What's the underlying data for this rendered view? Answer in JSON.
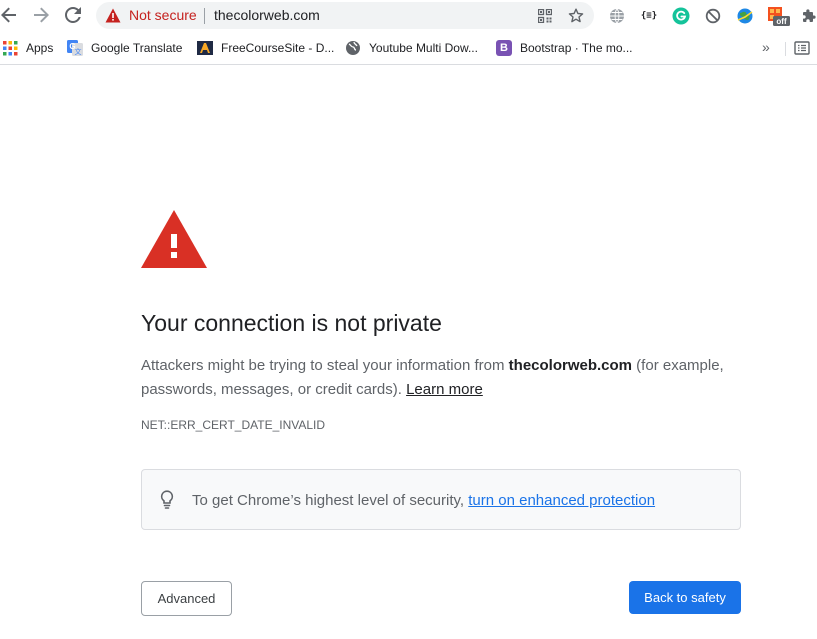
{
  "toolbar": {
    "back_icon": "arrow-left-icon",
    "forward_icon": "arrow-right-icon",
    "reload_icon": "reload-icon",
    "omnibox": {
      "security_status": "Not secure",
      "url": "thecolorweb.com",
      "warning_color": "#c5221f"
    },
    "extensions": [
      "globe-icon",
      "json-viewer-icon",
      "grammarly-icon",
      "block-icon",
      "earth-icon",
      "extension-off-icon",
      "puzzle-icon"
    ],
    "json_viewer_label": "{≡}",
    "ext_off_badge": "off"
  },
  "bookmarks": {
    "items": [
      {
        "label": "Apps",
        "icon": "apps-grid-icon"
      },
      {
        "label": "Google Translate",
        "icon": "google-translate-icon"
      },
      {
        "label": "FreeCourseSite - D...",
        "icon": "freecoursesite-icon"
      },
      {
        "label": "Youtube Multi Dow...",
        "icon": "globe-icon"
      },
      {
        "label": "Bootstrap · The mo...",
        "icon": "bootstrap-icon",
        "badge": "B"
      }
    ],
    "overflow_label": "»"
  },
  "interstitial": {
    "headline": "Your connection is not private",
    "explanation_prefix": "Attackers might be trying to steal your information from ",
    "site": "thecolorweb.com",
    "explanation_suffix": " (for example, passwords, messages, or credit cards). ",
    "learn_more": "Learn more",
    "error_code": "NET::ERR_CERT_DATE_INVALID",
    "security_prompt": "To get Chrome’s highest level of security, ",
    "enhanced_link": "turn on enhanced protection",
    "advanced_button": "Advanced",
    "back_button": "Back to safety",
    "accent_color": "#1a73e8",
    "danger_color": "#d93025"
  }
}
